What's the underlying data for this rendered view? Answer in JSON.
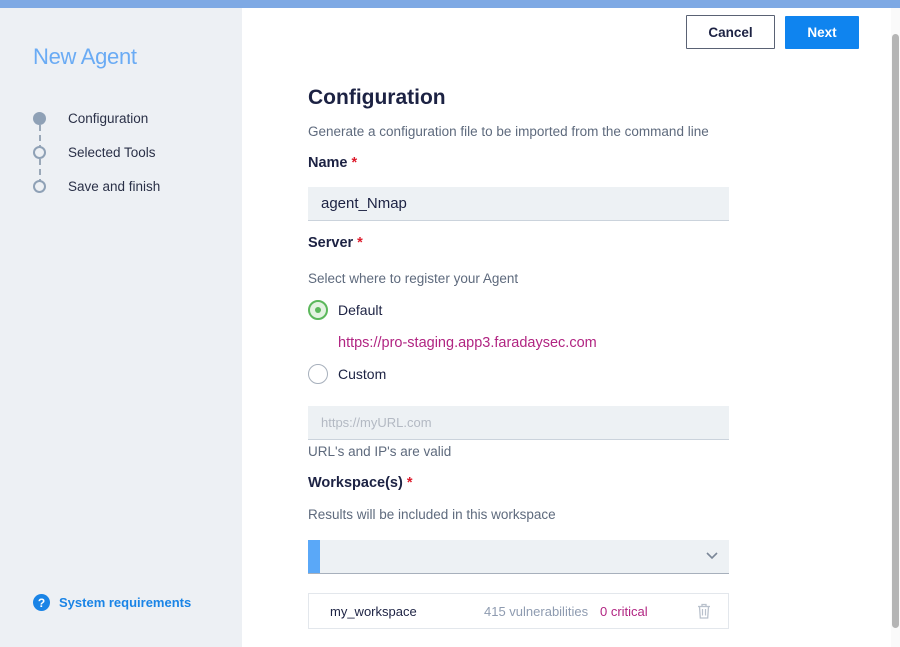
{
  "sidebar": {
    "title": "New Agent",
    "steps": [
      {
        "label": "Configuration",
        "active": true
      },
      {
        "label": "Selected Tools",
        "active": false
      },
      {
        "label": "Save and finish",
        "active": false
      }
    ],
    "system_requirements_label": "System requirements",
    "help_icon_glyph": "?"
  },
  "header": {
    "cancel_label": "Cancel",
    "next_label": "Next"
  },
  "form": {
    "title": "Configuration",
    "description": "Generate a configuration file to be imported from the command line",
    "name": {
      "label": "Name",
      "required_mark": "*",
      "value": "agent_Nmap"
    },
    "server": {
      "label": "Server",
      "required_mark": "*",
      "hint": "Select where to register your Agent",
      "selected": "Default",
      "options": [
        {
          "label": "Default",
          "url": "https://pro-staging.app3.faradaysec.com"
        },
        {
          "label": "Custom"
        }
      ],
      "custom_url_placeholder": "https://myURL.com",
      "custom_url_value": "",
      "custom_url_hint": "URL's and IP's are valid"
    },
    "workspaces": {
      "label": "Workspace(s)",
      "required_mark": "*",
      "hint": "Results will be included in this workspace",
      "select_value": "",
      "items": [
        {
          "name": "my_workspace",
          "vulnerabilities": "415 vulnerabilities",
          "critical": "0 critical"
        }
      ]
    }
  },
  "icons": {
    "help": "question-circle-icon",
    "chevron": "chevron-down-icon",
    "trash": "trash-icon"
  },
  "colors": {
    "accent": "#0f84ef",
    "sidebar_title": "#6aabf4",
    "required": "#dd1a2b",
    "link_magenta": "#b12582",
    "radio_checked": "#5cb85c"
  }
}
